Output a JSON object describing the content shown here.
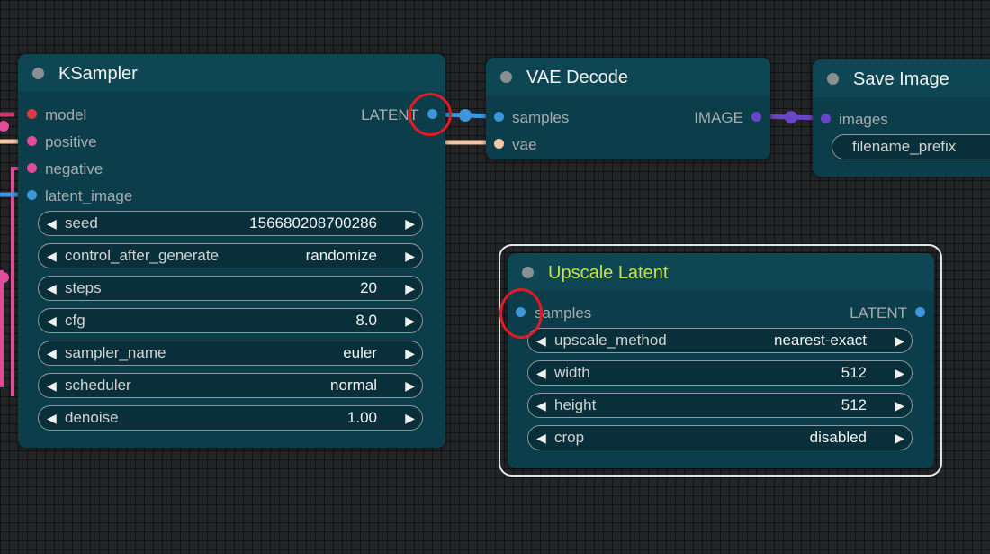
{
  "ksampler": {
    "title": "KSampler",
    "inputs": [
      {
        "label": "model",
        "color": "#e0383f"
      },
      {
        "label": "positive",
        "color": "#e24a9a"
      },
      {
        "label": "negative",
        "color": "#e24a9a"
      },
      {
        "label": "latent_image",
        "color": "#3b96dc"
      }
    ],
    "output": {
      "label": "LATENT",
      "color": "#3b96dc"
    },
    "widgets": [
      {
        "name": "seed",
        "value": "156680208700286"
      },
      {
        "name": "control_after_generate",
        "value": "randomize"
      },
      {
        "name": "steps",
        "value": "20"
      },
      {
        "name": "cfg",
        "value": "8.0"
      },
      {
        "name": "sampler_name",
        "value": "euler"
      },
      {
        "name": "scheduler",
        "value": "normal"
      },
      {
        "name": "denoise",
        "value": "1.00"
      }
    ]
  },
  "vae_decode": {
    "title": "VAE Decode",
    "inputs": [
      {
        "label": "samples",
        "color": "#3b96dc"
      },
      {
        "label": "vae",
        "color": "#f5c6a5"
      }
    ],
    "output": {
      "label": "IMAGE",
      "color": "#6b45c8"
    }
  },
  "save_image": {
    "title": "Save Image",
    "inputs": [
      {
        "label": "images",
        "color": "#6b45c8"
      }
    ],
    "widgets": [
      {
        "name": "filename_prefix"
      }
    ]
  },
  "upscale_latent": {
    "title": "Upscale Latent",
    "title_color": "#c8e04a",
    "inputs": [
      {
        "label": "samples",
        "color": "#3b96dc"
      }
    ],
    "output": {
      "label": "LATENT",
      "color": "#3b96dc"
    },
    "widgets": [
      {
        "name": "upscale_method",
        "value": "nearest-exact"
      },
      {
        "name": "width",
        "value": "512"
      },
      {
        "name": "height",
        "value": "512"
      },
      {
        "name": "crop",
        "value": "disabled"
      }
    ]
  },
  "glyphs": {
    "left_arrow": "◀",
    "right_arrow": "▶"
  }
}
